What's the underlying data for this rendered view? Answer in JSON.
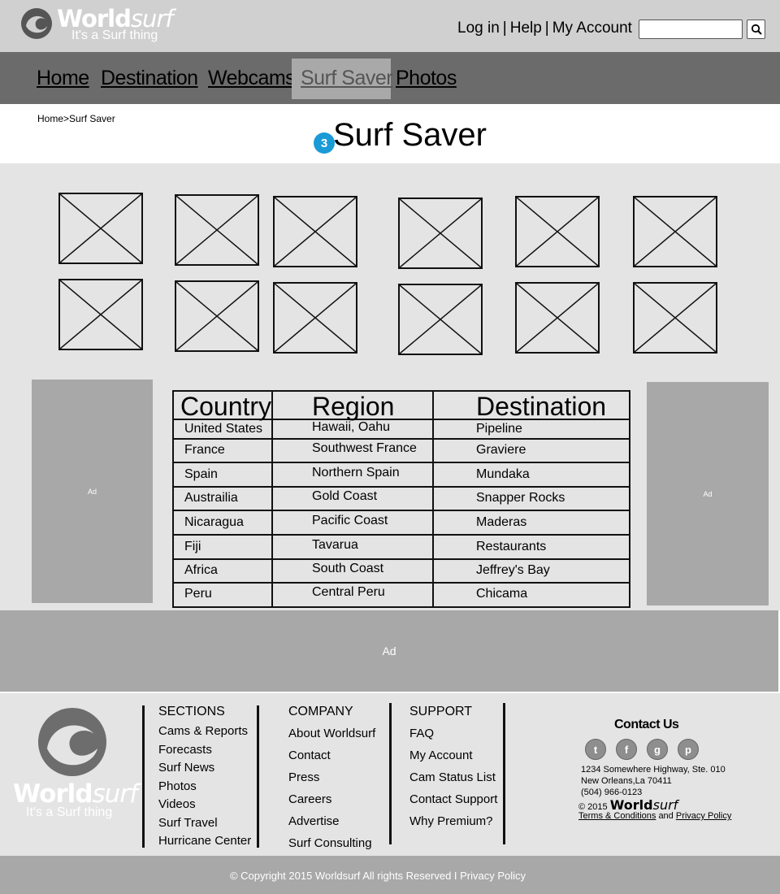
{
  "header": {
    "logo_bold": "World",
    "logo_italic": "surf",
    "tagline": "It's a Surf thing",
    "links": {
      "login": "Log in",
      "help": "Help",
      "account": "My Account",
      "separator": "|"
    },
    "search": {
      "placeholder": "",
      "icon": "search-icon"
    }
  },
  "nav": {
    "items": [
      "Home",
      "Destination",
      "Webcams",
      "Surf Saver",
      "Photos"
    ],
    "active": "Surf Saver"
  },
  "page": {
    "breadcrumb": "Home>Surf Saver",
    "step": "3",
    "title": "Surf Saver"
  },
  "ads": {
    "left": "Ad",
    "right": "Ad",
    "wide": "Ad"
  },
  "table": {
    "headers": [
      "Country",
      "Region",
      "Destination"
    ],
    "rows": [
      [
        "United States",
        "Hawaii, Oahu",
        "Pipeline"
      ],
      [
        "France",
        "Southwest France",
        "Graviere"
      ],
      [
        "Spain",
        "Northern Spain",
        "Mundaka"
      ],
      [
        "Austrailia",
        "Gold Coast",
        "Snapper Rocks"
      ],
      [
        "Nicaragua",
        "Pacific Coast",
        "Maderas"
      ],
      [
        "Fiji",
        "Tavarua",
        "Restaurants"
      ],
      [
        "Africa",
        "South Coast",
        "Jeffrey's Bay"
      ],
      [
        "Peru",
        "Central Peru",
        "Chicama"
      ]
    ]
  },
  "footer": {
    "logo_bold": "World",
    "logo_italic": "surf",
    "tagline": "It's a Surf thing",
    "sections": {
      "heading": "SECTIONS",
      "items": [
        "Cams & Reports",
        "Forecasts",
        "Surf News",
        "Photos",
        "Videos",
        "Surf Travel",
        "Hurricane Center"
      ]
    },
    "company": {
      "heading": "COMPANY",
      "items": [
        "About Worldsurf",
        "Contact",
        "Press",
        "Careers",
        "Advertise",
        "Surf Consulting"
      ]
    },
    "support": {
      "heading": "SUPPORT",
      "items": [
        "FAQ",
        "My Account",
        "Cam Status List",
        "Contact Support",
        "Why Premium?"
      ]
    },
    "contact": {
      "title": "Contact Us",
      "social": [
        "twitter-icon",
        "facebook-icon",
        "google-plus-icon",
        "pinterest-icon"
      ],
      "address_line1": "1234 Somewhere Highway, Ste. 010",
      "address_line2": "New Orleans,La 70411",
      "phone": "(504) 966-0123",
      "copyright_prefix": "© 2015",
      "brand_bold": "World",
      "brand_italic": "surf",
      "terms": "Terms & Conditions",
      "and": "and",
      "privacy": "Privacy Policy"
    },
    "copyright": "© Copyright 2015 Worldsurf All rights Reserved I Privacy Policy"
  },
  "colors": {
    "topbar": "#d0d0d0",
    "nav": "#6b6b6b",
    "nav_active": "#a9a9a9",
    "main": "#e4e4e4",
    "ad": "#a8a8a8",
    "step_badge": "#1a9ad6"
  }
}
